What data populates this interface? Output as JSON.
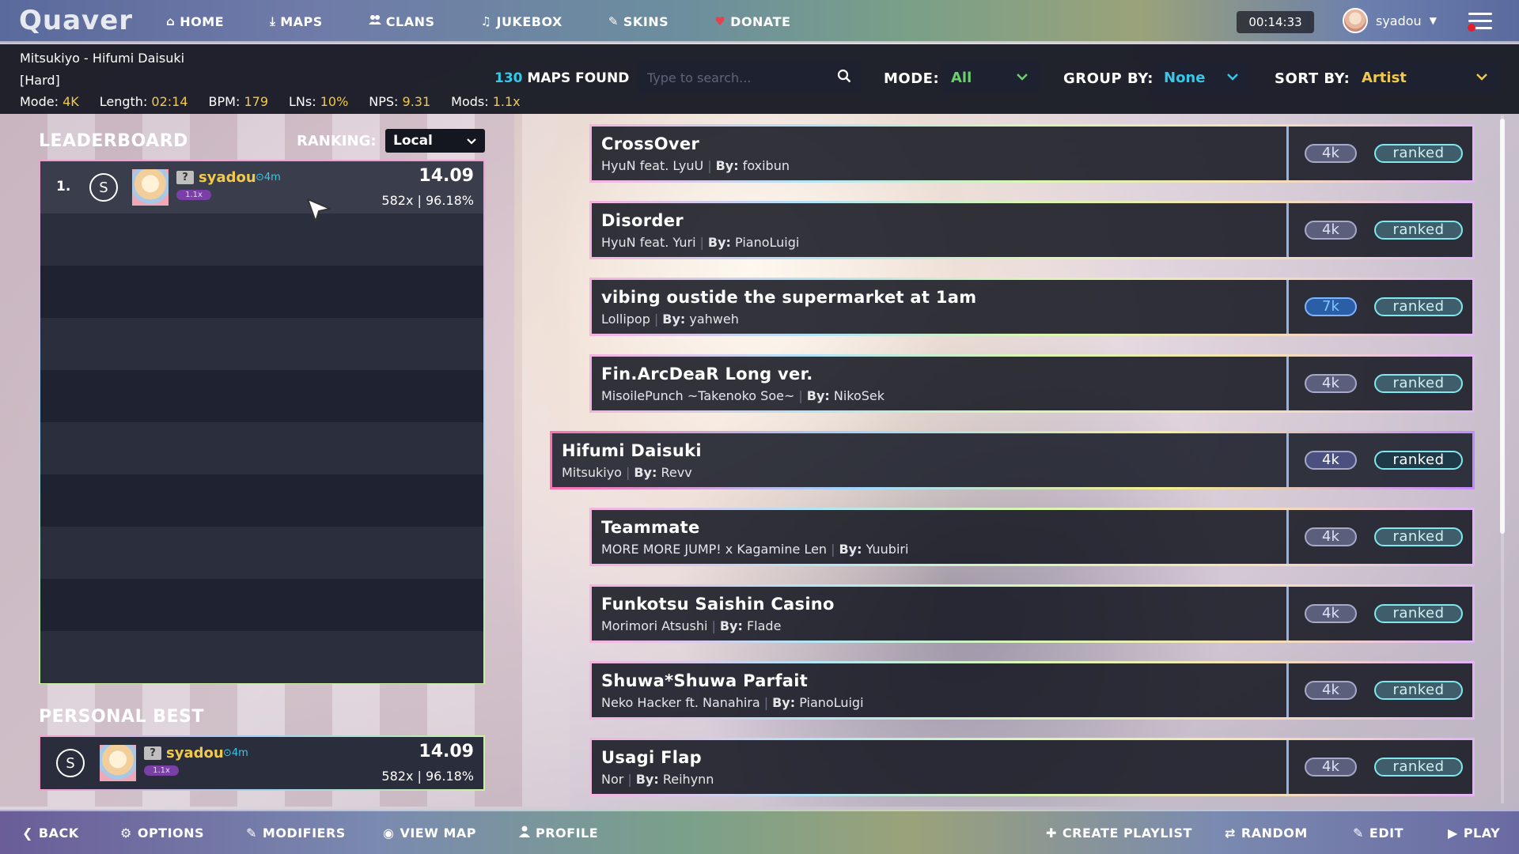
{
  "nav": {
    "logo": "Quaver",
    "items": [
      {
        "label": "HOME",
        "icon": "home-icon",
        "glyph": "⌂"
      },
      {
        "label": "MAPS",
        "icon": "download-icon",
        "glyph": "⤓"
      },
      {
        "label": "CLANS",
        "icon": "users-icon",
        "glyph": "👥"
      },
      {
        "label": "JUKEBOX",
        "icon": "music-icon",
        "glyph": "♫"
      },
      {
        "label": "SKINS",
        "icon": "brush-icon",
        "glyph": "✎"
      },
      {
        "label": "DONATE",
        "icon": "heart-icon",
        "glyph": "♥"
      }
    ],
    "timer": "00:14:33",
    "username": "syadou"
  },
  "song": {
    "title": "Mitsukiyo - Hifumi Daisuki",
    "difficulty": "[Hard]",
    "stats": [
      {
        "label": "Mode:",
        "value": "4K"
      },
      {
        "label": "Length:",
        "value": "02:14"
      },
      {
        "label": "BPM:",
        "value": "179"
      },
      {
        "label": "LNs:",
        "value": "10%"
      },
      {
        "label": "NPS:",
        "value": "9.31"
      },
      {
        "label": "Mods:",
        "value": "1.1x"
      }
    ]
  },
  "filters": {
    "maps_count": "130",
    "maps_found_label": "MAPS FOUND",
    "search_placeholder": "Type to search...",
    "mode_label": "MODE:",
    "mode_value": "All",
    "group_label": "GROUP BY:",
    "group_value": "None",
    "sort_label": "SORT BY:",
    "sort_value": "Artist"
  },
  "leaderboard": {
    "title": "LEADERBOARD",
    "ranking_label": "RANKING:",
    "ranking_value": "Local",
    "scores": [
      {
        "rank": "1.",
        "grade": "S",
        "badge": "?",
        "user": "syadou",
        "time": "⊙4m",
        "mods": "1.1x",
        "score": "14.09",
        "detail": "582x | 96.18%"
      }
    ]
  },
  "personal_best": {
    "title": "PERSONAL BEST",
    "grade": "S",
    "badge": "?",
    "user": "syadou",
    "time": "⊙4m",
    "mods": "1.1x",
    "score": "14.09",
    "detail": "582x | 96.18%"
  },
  "maps": [
    {
      "title": "CrossOver",
      "artist": "HyuN feat. LyuU",
      "by_label": "By:",
      "creator": "foxibun",
      "keys": "4k",
      "status": "ranked"
    },
    {
      "title": "Disorder",
      "artist": "HyuN feat. Yuri",
      "by_label": "By:",
      "creator": "PianoLuigi",
      "keys": "4k",
      "status": "ranked"
    },
    {
      "title": "vibing oustide the supermarket at 1am",
      "artist": "Lollipop",
      "by_label": "By:",
      "creator": "yahweh",
      "keys": "7k",
      "status": "ranked"
    },
    {
      "title": "Fin.ArcDeaR Long ver.",
      "artist": "MisoilePunch ~Takenoko Soe~",
      "by_label": "By:",
      "creator": "NikoSek",
      "keys": "4k",
      "status": "ranked"
    },
    {
      "title": "Hifumi Daisuki",
      "artist": "Mitsukiyo",
      "by_label": "By:",
      "creator": "Revv",
      "keys": "4k",
      "status": "ranked",
      "selected": true
    },
    {
      "title": "Teammate",
      "artist": "MORE MORE JUMP! x Kagamine Len",
      "by_label": "By:",
      "creator": "Yuubiri",
      "keys": "4k",
      "status": "ranked"
    },
    {
      "title": "Funkotsu Saishin Casino",
      "artist": "Morimori Atsushi",
      "by_label": "By:",
      "creator": "Flade",
      "keys": "4k",
      "status": "ranked"
    },
    {
      "title": "Shuwa*Shuwa Parfait",
      "artist": "Neko Hacker ft. Nanahira",
      "by_label": "By:",
      "creator": "PianoLuigi",
      "keys": "4k",
      "status": "ranked"
    },
    {
      "title": "Usagi Flap",
      "artist": "Nor",
      "by_label": "By:",
      "creator": "Reihynn",
      "keys": "4k",
      "status": "ranked"
    }
  ],
  "bottom": {
    "back": "BACK",
    "options": "OPTIONS",
    "modifiers": "MODIFIERS",
    "view_map": "VIEW MAP",
    "profile": "PROFILE",
    "create_playlist": "CREATE PLAYLIST",
    "random": "RANDOM",
    "edit": "EDIT",
    "play": "PLAY"
  },
  "colors": {
    "accent_yellow": "#f2c94c",
    "accent_cyan": "#35c8e8",
    "accent_green": "#6bd06b",
    "donate_red": "#e8404f"
  }
}
